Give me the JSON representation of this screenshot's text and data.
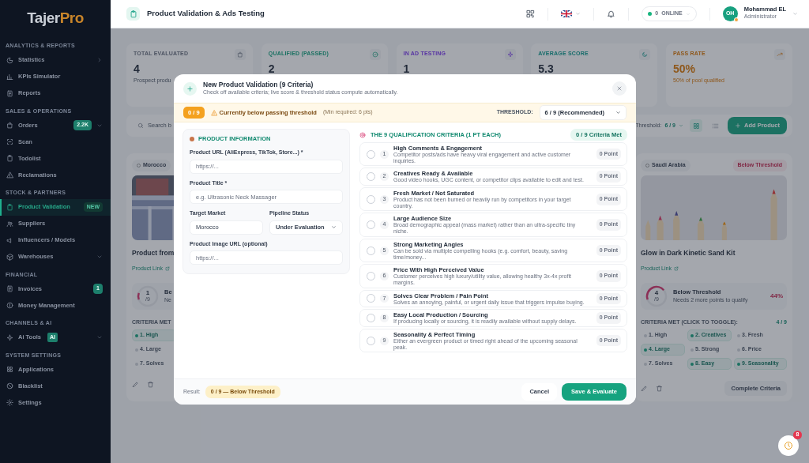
{
  "sidebar": {
    "logo": {
      "part_a": "Tajer",
      "part_b": "Pro"
    },
    "sections": [
      {
        "title": "ANALYTICS & REPORTS",
        "items": [
          {
            "label": "Statistics",
            "selected": false,
            "flyout": true,
            "dropdown": false
          },
          {
            "label": "KPIs Simulator",
            "selected": false,
            "flyout": false,
            "dropdown": false
          },
          {
            "label": "Reports",
            "selected": false,
            "flyout": false,
            "dropdown": false
          }
        ]
      },
      {
        "title": "SALES & OPERATIONS",
        "items": [
          {
            "label": "Orders",
            "selected": false,
            "badge": {
              "text": "2.2K",
              "inline": false
            },
            "flyout": false,
            "dropdown": true
          },
          {
            "label": "Scan",
            "selected": false,
            "flyout": false,
            "dropdown": false
          },
          {
            "label": "Todolist",
            "selected": false,
            "flyout": false,
            "dropdown": false
          },
          {
            "label": "Reclamations",
            "selected": false,
            "flyout": false,
            "dropdown": false
          }
        ]
      },
      {
        "title": "STOCK & PARTNERS",
        "items": [
          {
            "label": "Product Validation",
            "selected": true,
            "badge": {
              "text": "NEW",
              "inline": false
            },
            "flyout": false,
            "dropdown": false
          },
          {
            "label": "Suppliers",
            "selected": false,
            "flyout": false,
            "dropdown": false
          },
          {
            "label": "Influencers / Models",
            "selected": false,
            "flyout": false,
            "dropdown": false
          },
          {
            "label": "Warehouses",
            "selected": false,
            "flyout": false,
            "dropdown": true
          }
        ]
      },
      {
        "title": "FINANCIAL",
        "items": [
          {
            "label": "Invoices",
            "selected": false,
            "badge": {
              "text": "1",
              "inline": false
            },
            "flyout": false,
            "dropdown": false
          },
          {
            "label": "Money Management",
            "selected": false,
            "flyout": false,
            "dropdown": false
          }
        ]
      },
      {
        "title": "CHANNELS & AI",
        "items": [
          {
            "label": "Ai Tools",
            "selected": false,
            "badge": {
              "text": "AI",
              "inline": true
            },
            "flyout": false,
            "dropdown": true
          }
        ]
      },
      {
        "title": "SYSTEM SETTINGS",
        "items": [
          {
            "label": "Applications",
            "selected": false,
            "flyout": false,
            "dropdown": false
          },
          {
            "label": "Blacklist",
            "selected": false,
            "flyout": false,
            "dropdown": false
          },
          {
            "label": "Settings",
            "selected": false,
            "flyout": false,
            "dropdown": false
          }
        ]
      }
    ]
  },
  "header": {
    "title": "Product Validation & Ads Testing",
    "online": {
      "count": "0",
      "label": "ONLINE"
    },
    "user": {
      "initials": "OH",
      "name": "Mohammad EL",
      "role": "Administrator"
    }
  },
  "stats": [
    {
      "kind": "total",
      "title": "TOTAL EVALUATED",
      "value": "4",
      "note": "Prospect produ",
      "highlight": false
    },
    {
      "kind": "qualified",
      "title": "QUALIFIED (PASSED)",
      "value": "2",
      "highlight": false
    },
    {
      "kind": "testing",
      "title": "IN AD TESTING",
      "value": "1",
      "highlight": false
    },
    {
      "kind": "average",
      "title": "AVERAGE SCORE",
      "value": "5.3",
      "highlight": false
    },
    {
      "kind": "rate",
      "title": "PASS RATE",
      "value": "50%",
      "note": "50% of pool qualified",
      "highlight": true
    }
  ],
  "toolbar": {
    "search_placeholder": "Search b",
    "threshold_label": "Threshold:",
    "threshold_value": "6 / 9",
    "views": [
      {
        "kind": "grid",
        "selected": true
      },
      {
        "kind": "list",
        "selected": false
      }
    ],
    "add_button": "Add Product"
  },
  "cards": [
    {
      "market": "Morocco",
      "kind": "picture",
      "title": "Product from",
      "link": "Product Link",
      "score": "1",
      "score_max": "/9",
      "level": 0.11,
      "status_title": "Be",
      "status_note": "Ne",
      "criteria_label": "CRITERIA MET",
      "chip_rows": [
        [
          {
            "label": "1. High",
            "selected": true
          }
        ],
        [
          {
            "label": "4. Large",
            "selected": false
          }
        ],
        [
          {
            "label": "7. Solves",
            "selected": false
          }
        ]
      ]
    },
    {
      "market": "Saudi Arabia",
      "badge": "Below Threshold",
      "kind": "picture",
      "title": "Glow in Dark Kinetic Sand Kit",
      "link": "Product Link",
      "score": "4",
      "score_max": "/9",
      "level": 0.44,
      "status_title": "Below Threshold",
      "status_note": "Needs 2 more points to qualify",
      "percent": "44%",
      "criteria_label": "CRITERIA MET (CLICK TO TOGGLE):",
      "count": "4 / 9",
      "chip_rows": [
        [
          {
            "label": "1. High",
            "selected": false
          },
          {
            "label": "2. Creatives",
            "selected": true
          },
          {
            "label": "3. Fresh",
            "selected": false
          }
        ],
        [
          {
            "label": "4. Large",
            "selected": true
          },
          {
            "label": "5. Strong",
            "selected": false
          },
          {
            "label": "6. Price",
            "selected": false
          }
        ],
        [
          {
            "label": "7. Solves",
            "selected": false
          },
          {
            "label": "8. Easy",
            "selected": true
          },
          {
            "label": "9. Seasonality",
            "selected": true
          }
        ]
      ],
      "action": "Complete Criteria"
    }
  ],
  "modal": {
    "title": "New Product Validation (9 Criteria)",
    "subtitle": "Check off available criteria; live score & threshold status compute automatically.",
    "alert": {
      "score": "0 / 9",
      "message": "Currently below passing threshold",
      "hint": "(Min required: 6 pts)",
      "threshold_label": "THRESHOLD:",
      "threshold_value": "6 / 9 (Recommended)"
    },
    "info": {
      "heading": "PRODUCT INFORMATION",
      "rows": [
        [
          {
            "kind": "input",
            "label": "Product URL (AliExpress, TikTok, Store...) *",
            "placeholder": "https://..."
          }
        ],
        [
          {
            "kind": "input",
            "label": "Product Title *",
            "placeholder": "e.g. Ultrasonic Neck Massager"
          }
        ],
        [
          {
            "kind": "input",
            "label": "Target Market",
            "value": "Morocco"
          },
          {
            "kind": "select",
            "label": "Pipeline Status",
            "value": "Under Evaluation"
          }
        ],
        [
          {
            "kind": "input",
            "label": "Product Image URL (optional)",
            "placeholder": "https://..."
          }
        ]
      ]
    },
    "criteria_heading": "THE 9 QUALIFICATION CRITERIA (1 PT EACH)",
    "criteria_met": "0 / 9 Criteria Met",
    "criteria": [
      {
        "number": "1",
        "title": "High Comments & Engagement",
        "description": "Competitor posts/ads have heavy viral engagement and active customer inquiries.",
        "points": "0 Point",
        "checked": false
      },
      {
        "number": "2",
        "title": "Creatives Ready & Available",
        "description": "Good video hooks, UGC content, or competitor clips available to edit and test.",
        "points": "0 Point",
        "checked": false
      },
      {
        "number": "3",
        "title": "Fresh Market / Not Saturated",
        "description": "Product has not been burned or heavily run by competitors in your target country.",
        "points": "0 Point",
        "checked": false
      },
      {
        "number": "4",
        "title": "Large Audience Size",
        "description": "Broad demographic appeal (mass market) rather than an ultra-specific tiny niche.",
        "points": "0 Point",
        "checked": false
      },
      {
        "number": "5",
        "title": "Strong Marketing Angles",
        "description": "Can be sold via multiple compelling hooks (e.g. comfort, beauty, saving time/money...",
        "points": "0 Point",
        "checked": false
      },
      {
        "number": "6",
        "title": "Price With High Perceived Value",
        "description": "Customer perceives high luxury/utility value, allowing healthy 3x-4x profit margins.",
        "points": "0 Point",
        "checked": false
      },
      {
        "number": "7",
        "title": "Solves Clear Problem / Pain Point",
        "description": "Solves an annoying, painful, or urgent daily issue that triggers impulse buying.",
        "points": "0 Point",
        "checked": false
      },
      {
        "number": "8",
        "title": "Easy Local Production / Sourcing",
        "description": "If producing locally or sourcing, it is readily available without supply delays.",
        "points": "0 Point",
        "checked": false
      },
      {
        "number": "9",
        "title": "Seasonality & Perfect Timing",
        "description": "Either an evergreen product or timed right ahead of the upcoming seasonal peak.",
        "points": "0 Point",
        "checked": false
      }
    ],
    "footer": {
      "result_label": "Result:",
      "result": "0 / 9 — Below Threshold",
      "cancel": "Cancel",
      "save": "Save & Evaluate"
    }
  },
  "fab": {
    "badge": "8"
  }
}
